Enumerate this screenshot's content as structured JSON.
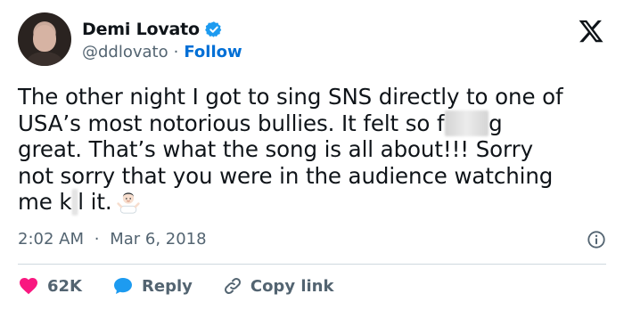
{
  "author": {
    "name": "Demi Lovato",
    "handle": "@ddlovato",
    "separator": "·",
    "follow_label": "Follow",
    "verified_icon": "verified-badge-icon"
  },
  "brand": {
    "logo_icon": "x-logo-icon"
  },
  "tweet": {
    "line1": "The other night I got to sing SNS directly to one of",
    "line2": "USA’s most notorious bullies. It felt so f",
    "line2_blurred": "ucki",
    "line2_end": "g",
    "line3": "great. That’s what the song is all about!!! Sorry",
    "line4": "not sorry that you were in the audience watching",
    "line5_start": "me k",
    "line5_blurred": "i",
    "line5_end": "l it.",
    "emoji": "person-shrugging-emoji"
  },
  "meta": {
    "time": "2:02 AM",
    "separator": "·",
    "date": "Mar 6, 2018"
  },
  "actions": {
    "like_count": "62K",
    "reply_label": "Reply",
    "copy_link_label": "Copy link"
  },
  "colors": {
    "like": "#f91880",
    "reply": "#1d9bf0",
    "link": "#006fd6",
    "verified": "#1d9bf0",
    "muted": "#536471"
  }
}
